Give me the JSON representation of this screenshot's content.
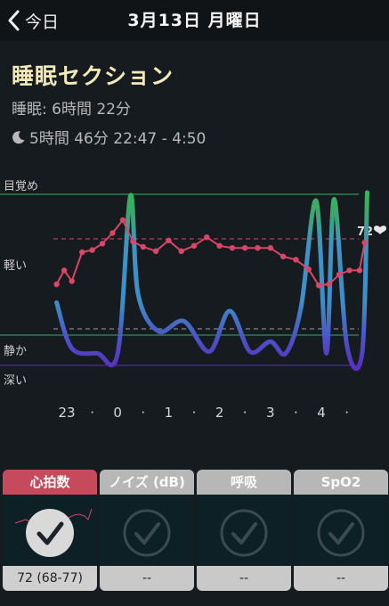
{
  "nav": {
    "back_label": "今日",
    "title": "3月13日 月曜日"
  },
  "header": {
    "title": "睡眠セクション",
    "sleep_line": "睡眠: 6時間 22分",
    "detail_icon": "moon-icon",
    "detail_line": "5時間 46分 22:47 - 4:50"
  },
  "chart_data": {
    "type": "line",
    "stage_labels": [
      "目覚め",
      "軽い",
      "静か",
      "深い"
    ],
    "x_ticks": [
      "23",
      "·",
      "0",
      "·",
      "1",
      "·",
      "2",
      "·",
      "3",
      "·",
      "4",
      "·"
    ],
    "heart_rate_label": "72",
    "series": [
      {
        "type": "sleep-stage-curve",
        "x": [
          22.8,
          23.1,
          23.6,
          24.0,
          24.25,
          24.4,
          24.8,
          25.3,
          25.8,
          26.2,
          26.6,
          27.0,
          27.3,
          27.6,
          27.9,
          28.1,
          28.25,
          28.5,
          28.8,
          28.9
        ],
        "y": [
          0.35,
          0.08,
          0.05,
          0.05,
          0.98,
          0.4,
          0.18,
          0.24,
          0.06,
          0.3,
          0.06,
          0.12,
          0.05,
          0.32,
          0.95,
          0.05,
          0.96,
          0.1,
          0.05,
          1.0
        ]
      },
      {
        "type": "heart-rate",
        "x": [
          22.8,
          22.95,
          23.1,
          23.3,
          23.5,
          23.7,
          23.9,
          24.1,
          24.3,
          24.5,
          24.75,
          25.0,
          25.25,
          25.5,
          25.75,
          26.0,
          26.25,
          26.5,
          26.75,
          27.0,
          27.25,
          27.5,
          27.75,
          27.95,
          28.15,
          28.35,
          28.55,
          28.75,
          28.85
        ],
        "y": [
          68.5,
          69.8,
          68.8,
          71.5,
          71.7,
          72.3,
          73.3,
          74.5,
          72.5,
          72.0,
          71.6,
          72.6,
          71.6,
          72.1,
          72.9,
          72.1,
          71.9,
          71.9,
          71.9,
          71.9,
          71.1,
          70.8,
          69.9,
          68.4,
          68.5,
          69.4,
          69.8,
          69.8,
          72.4
        ]
      }
    ],
    "colors": {
      "heart_rate": "#d94666",
      "deep": "#5a2ec0",
      "light": "#3e94c9",
      "awake": "#35b65b",
      "ref_line": "#d94666"
    }
  },
  "tabs": [
    {
      "label": "心拍数",
      "value": "72 (68-77)",
      "icon": "check-circle-icon",
      "active": true
    },
    {
      "label": "ノイズ (dB)",
      "value": "--",
      "icon": "check-circle-icon",
      "active": false
    },
    {
      "label": "呼吸",
      "value": "--",
      "icon": "check-circle-icon",
      "active": false
    },
    {
      "label": "SpO2",
      "value": "--",
      "icon": "check-circle-icon",
      "active": false
    }
  ]
}
